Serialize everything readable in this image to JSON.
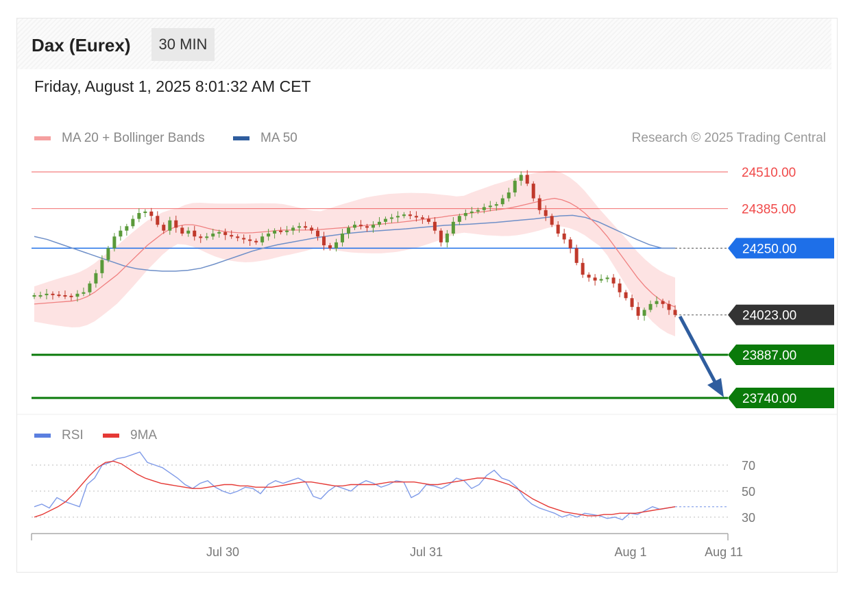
{
  "header": {
    "instrument": "Dax (Eurex)",
    "timeframe": "30 MIN",
    "datetime": "Friday, August 1, 2025 8:01:32 AM CET",
    "credit": "Research © 2025 Trading Central"
  },
  "legend_main": [
    {
      "label": "MA 20 + Bollinger Bands",
      "color": "#f08080"
    },
    {
      "label": "MA 50",
      "color": "#2f5d9e"
    }
  ],
  "legend_rsi": [
    {
      "label": "RSI",
      "color": "#5b7fe0"
    },
    {
      "label": "9MA",
      "color": "#e53935"
    }
  ],
  "colors": {
    "resistance": "#f04a4a",
    "pivot": "#1e6fe8",
    "support": "#0a7a0a",
    "last": "#333333",
    "arrow": "#2f5d9e",
    "candle_up": "#5a9a3a",
    "candle_down": "#c0392b",
    "bollinger_fill": "#fde0e0"
  },
  "chart_data": [
    {
      "type": "candlestick",
      "title": "Dax (Eurex)",
      "timeframe": "30 MIN",
      "y_range": [
        23740,
        24560
      ],
      "x_ticks": [
        "Jul 30",
        "Jul 31",
        "Aug 1",
        "Aug 11"
      ],
      "levels": [
        {
          "value": 24510.0,
          "label": "24510.00",
          "kind": "resistance"
        },
        {
          "value": 24385.0,
          "label": "24385.00",
          "kind": "resistance"
        },
        {
          "value": 24250.0,
          "label": "24250.00",
          "kind": "pivot"
        },
        {
          "value": 24023.0,
          "label": "24023.00",
          "kind": "last"
        },
        {
          "value": 23887.0,
          "label": "23887.00",
          "kind": "support"
        },
        {
          "value": 23740.0,
          "label": "23740.00",
          "kind": "support"
        }
      ],
      "close_path": [
        24090,
        24090,
        24095,
        24092,
        24090,
        24088,
        24085,
        24095,
        24100,
        24130,
        24165,
        24210,
        24250,
        24290,
        24310,
        24325,
        24350,
        24370,
        24375,
        24360,
        24330,
        24310,
        24345,
        24320,
        24300,
        24310,
        24290,
        24285,
        24290,
        24300,
        24305,
        24295,
        24290,
        24285,
        24280,
        24275,
        24270,
        24290,
        24300,
        24310,
        24305,
        24310,
        24320,
        24325,
        24320,
        24310,
        24290,
        24260,
        24250,
        24270,
        24300,
        24320,
        24330,
        24325,
        24320,
        24330,
        24340,
        24350,
        24355,
        24360,
        24365,
        24360,
        24355,
        24350,
        24340,
        24310,
        24270,
        24300,
        24340,
        24360,
        24370,
        24375,
        24380,
        24390,
        24395,
        24400,
        24420,
        24440,
        24480,
        24500,
        24470,
        24420,
        24380,
        24360,
        24330,
        24300,
        24280,
        24250,
        24200,
        24160,
        24150,
        24140,
        24145,
        24150,
        24130,
        24100,
        24080,
        24050,
        24020,
        24040,
        24060,
        24070,
        24060,
        24040,
        24023
      ],
      "ma20": [
        24060,
        24062,
        24064,
        24066,
        24068,
        24070,
        24075,
        24085,
        24100,
        24120,
        24140,
        24160,
        24185,
        24210,
        24235,
        24260,
        24280,
        24300,
        24315,
        24325,
        24330,
        24330,
        24325,
        24318,
        24312,
        24308,
        24305,
        24303,
        24302,
        24303,
        24305,
        24307,
        24310,
        24312,
        24312,
        24312,
        24312,
        24313,
        24314,
        24316,
        24318,
        24320,
        24322,
        24325,
        24328,
        24330,
        24332,
        24335,
        24337,
        24340,
        24343,
        24346,
        24350,
        24353,
        24356,
        24360,
        24363,
        24366,
        24370,
        24373,
        24376,
        24380,
        24383,
        24387,
        24392,
        24398,
        24404,
        24410,
        24416,
        24420,
        24415,
        24405,
        24390,
        24370,
        24345,
        24320,
        24290,
        24255,
        24220,
        24185,
        24150,
        24120,
        24095,
        24075,
        24060,
        24050
      ],
      "ma50": [
        24290,
        24280,
        24265,
        24250,
        24235,
        24220,
        24205,
        24190,
        24180,
        24175,
        24172,
        24172,
        24175,
        24182,
        24195,
        24210,
        24225,
        24240,
        24252,
        24262,
        24270,
        24278,
        24286,
        24292,
        24298,
        24303,
        24307,
        24310,
        24313,
        24316,
        24320,
        24324,
        24328,
        24330,
        24332,
        24335,
        24338,
        24342,
        24346,
        24350,
        24355,
        24360,
        24362,
        24355,
        24340,
        24320,
        24300,
        24280,
        24262,
        24250,
        24250
      ],
      "rsi_panel": {
        "levels": [
          "70",
          "50",
          "30"
        ],
        "rsi": [
          38,
          40,
          37,
          45,
          42,
          40,
          38,
          55,
          60,
          70,
          72,
          75,
          76,
          78,
          80,
          72,
          70,
          68,
          64,
          60,
          55,
          52,
          56,
          58,
          53,
          50,
          48,
          50,
          53,
          52,
          48,
          55,
          58,
          56,
          58,
          60,
          57,
          46,
          44,
          50,
          54,
          52,
          50,
          55,
          58,
          56,
          53,
          55,
          58,
          57,
          45,
          48,
          55,
          54,
          52,
          55,
          60,
          58,
          52,
          55,
          62,
          66,
          60,
          58,
          53,
          45,
          40,
          37,
          35,
          33,
          30,
          32,
          30,
          33,
          32,
          31,
          29,
          30,
          28,
          33,
          32,
          35,
          38,
          36,
          37,
          38
        ],
        "ma9": [
          30,
          32,
          35,
          38,
          42,
          48,
          55,
          62,
          68,
          72,
          73,
          71,
          67,
          63,
          60,
          58,
          56,
          55,
          54,
          53,
          52,
          52,
          53,
          54,
          55,
          55,
          54,
          54,
          53,
          53,
          53,
          54,
          55,
          56,
          57,
          57,
          56,
          55,
          54,
          54,
          55,
          55,
          55,
          55,
          56,
          57,
          57,
          57,
          57,
          56,
          55,
          55,
          56,
          57,
          58,
          59,
          60,
          60,
          59,
          57,
          55,
          52,
          48,
          44,
          41,
          38,
          36,
          34,
          33,
          32,
          31,
          31,
          32,
          32,
          33,
          33,
          33,
          34,
          35,
          36,
          37,
          38
        ]
      }
    }
  ]
}
